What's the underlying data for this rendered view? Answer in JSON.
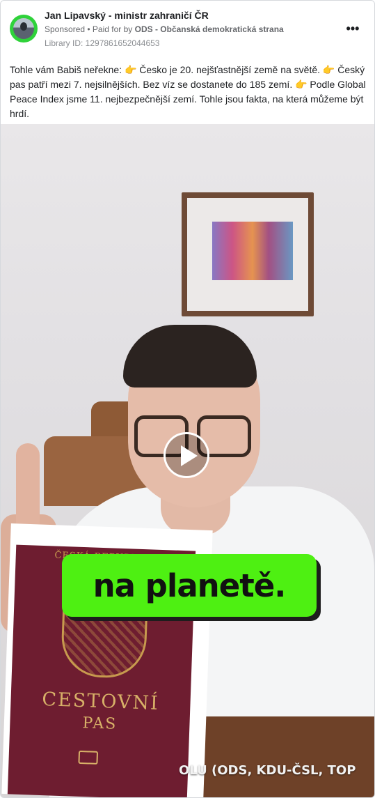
{
  "post": {
    "author": "Jan Lipavský - ministr zahraničí ČR",
    "sponsored": "Sponsored",
    "separator": " • ",
    "paid_for_prefix": "Paid for by ",
    "paid_for_by": "ODS - Občanská demokratická strana",
    "library_id": "Library ID: 1297861652044653",
    "more_icon": "more-horizontal-icon",
    "text": "Tohle vám Babiš neřekne: 👉 Česko je 20. nejšťastnější země na světě. 👉 Český pas patří mezi 7. nejsilnějších. Bez víz se dostanete do 185 zemí. 👉 Podle Global Peace Index jsme 11. nejbezpečnější zemí. Tohle jsou fakta, na která můžeme být hrdí."
  },
  "video": {
    "caption": "na planetě.",
    "bottom_text": "OLU (ODS, KDU-ČSL, TOP",
    "passport_title": "CESTOVNÍ",
    "passport_subtitle": "PAS",
    "passport_top": "ČESKÁ REPUBLIKA",
    "play_icon": "play-icon",
    "caption_color": "#4ef012"
  }
}
